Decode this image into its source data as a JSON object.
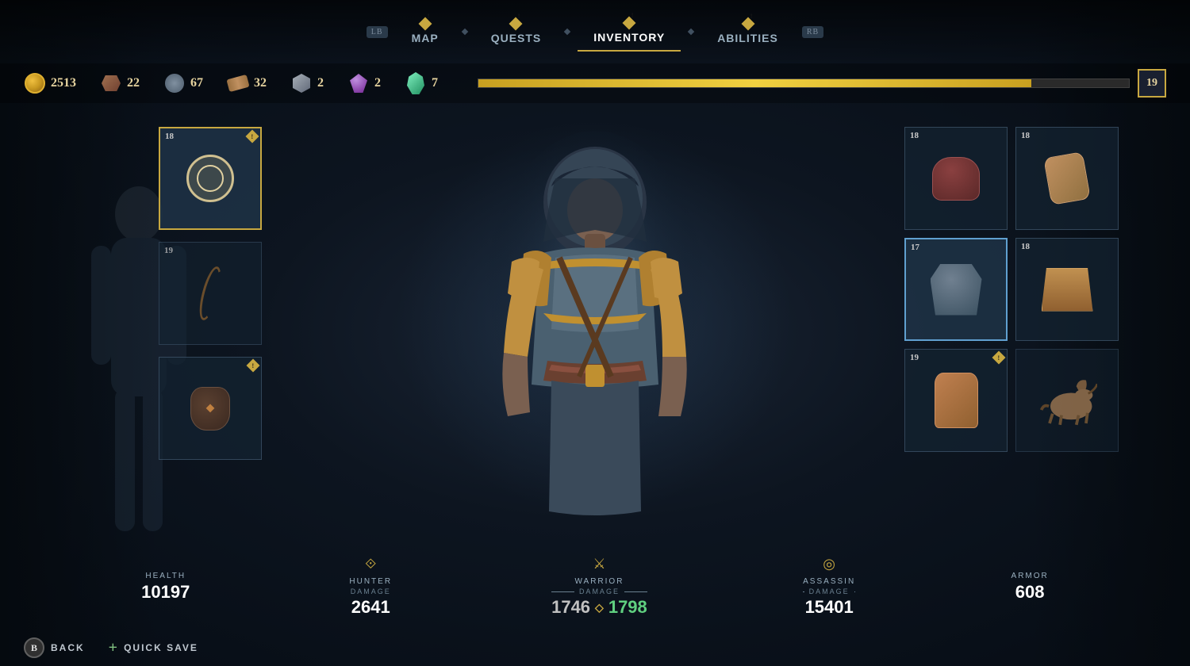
{
  "nav": {
    "items": [
      {
        "id": "map",
        "label": "Map",
        "button": "LB",
        "active": false,
        "has_diamond": false
      },
      {
        "id": "quests",
        "label": "Quests",
        "button": "",
        "active": false,
        "has_diamond": true
      },
      {
        "id": "inventory",
        "label": "Inventory",
        "button": "",
        "active": true,
        "has_diamond": true
      },
      {
        "id": "abilities",
        "label": "Abilities",
        "button": "",
        "active": false,
        "has_diamond": true
      },
      {
        "id": "rb",
        "label": "",
        "button": "RB",
        "active": false,
        "has_diamond": false
      }
    ]
  },
  "resources": {
    "gold": {
      "value": "2513"
    },
    "leather": {
      "value": "22"
    },
    "stone": {
      "value": "67"
    },
    "wood": {
      "value": "32"
    },
    "metal": {
      "value": "2"
    },
    "gem_purple": {
      "value": "2"
    },
    "crystal": {
      "value": "7"
    },
    "level": {
      "value": "19"
    },
    "xp_percent": 85
  },
  "equipment": {
    "left_slots": [
      {
        "id": "weapon_main",
        "level": "18",
        "has_exclaim": false
      },
      {
        "id": "weapon_secondary",
        "level": "19",
        "has_exclaim": false
      },
      {
        "id": "consumable",
        "level": "",
        "has_exclaim": true
      }
    ],
    "right_slots": [
      {
        "id": "head",
        "level": "18",
        "has_exclaim": false,
        "col": 1,
        "row": 1
      },
      {
        "id": "bracer",
        "level": "18",
        "has_exclaim": false,
        "col": 2,
        "row": 1
      },
      {
        "id": "chest",
        "level": "17",
        "has_exclaim": false,
        "col": 1,
        "row": 2
      },
      {
        "id": "waist",
        "level": "18",
        "has_exclaim": false,
        "col": 2,
        "row": 2
      },
      {
        "id": "legs",
        "level": "19",
        "has_exclaim": true,
        "col": 1,
        "row": 3
      },
      {
        "id": "mount",
        "level": "",
        "has_exclaim": false,
        "col": 2,
        "row": 3
      }
    ]
  },
  "stats": {
    "health": {
      "label": "Health",
      "icon": "♥",
      "value": "10197"
    },
    "hunter": {
      "label": "Hunter",
      "sublabel": "Damage",
      "icon": "⟐",
      "value": "2641"
    },
    "warrior": {
      "label": "Warrior",
      "sublabel": "Damage",
      "icon": "⚔",
      "value_old": "1746",
      "value_new": "1798",
      "updated": true
    },
    "assassin": {
      "label": "Assassin",
      "sublabel": "Damage",
      "icon": "◎",
      "value": "15401"
    },
    "armor": {
      "label": "Armor",
      "icon": "🛡",
      "value": "608"
    }
  },
  "controls": {
    "back": {
      "button": "B",
      "label": "Back"
    },
    "quick_save": {
      "button": "+",
      "label": "Quick Save"
    }
  }
}
